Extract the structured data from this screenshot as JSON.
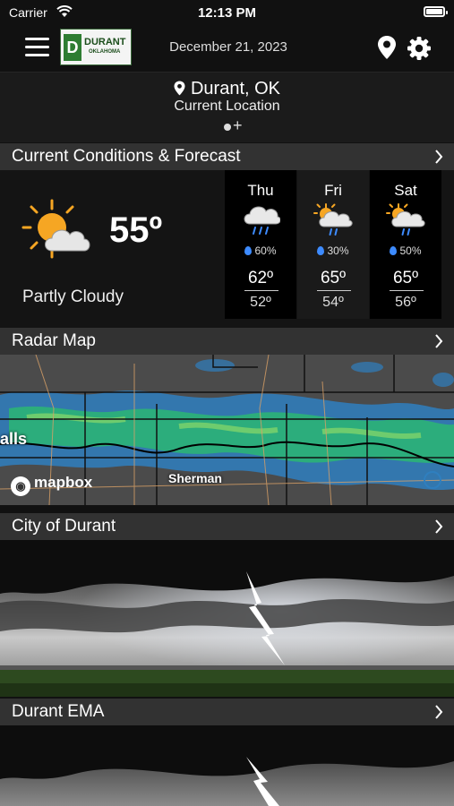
{
  "status_bar": {
    "carrier": "Carrier",
    "time": "12:13 PM"
  },
  "header": {
    "logo_text": "DURANT",
    "logo_subtext": "OKLAHOMA",
    "logo_letter": "D",
    "date": "December 21, 2023"
  },
  "location": {
    "city": "Durant, OK",
    "subtitle": "Current Location"
  },
  "sections": {
    "conditions": "Current Conditions & Forecast",
    "radar": "Radar Map",
    "city": "City of Durant",
    "ema": "Durant EMA"
  },
  "current": {
    "temp": "55º",
    "description": "Partly Cloudy",
    "icon": "partly-cloudy-icon"
  },
  "forecast": [
    {
      "day": "Thu",
      "precip": "60%",
      "high": "62º",
      "low": "52º",
      "icon": "rain-cloud-icon"
    },
    {
      "day": "Fri",
      "precip": "30%",
      "high": "65º",
      "low": "54º",
      "icon": "partly-cloudy-rain-icon"
    },
    {
      "day": "Sat",
      "precip": "50%",
      "high": "65º",
      "low": "56º",
      "icon": "partly-cloudy-rain-icon"
    }
  ],
  "radar": {
    "city_label": "Sherman",
    "left_label": "alls",
    "attribution": "mapbox"
  },
  "colors": {
    "accent_green": "#2e7d32",
    "precip_drop": "#3d8bff",
    "section_bar": "#323232"
  }
}
